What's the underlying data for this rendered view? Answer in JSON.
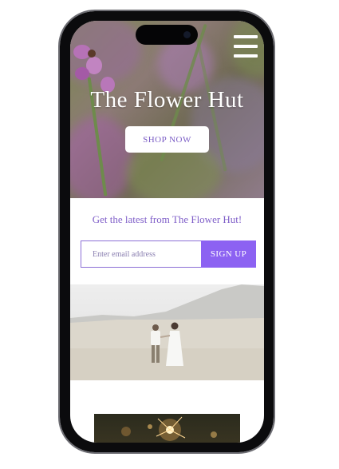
{
  "hero": {
    "brand_title": "The Flower Hut",
    "shop_button": "SHOP NOW",
    "menu_icon": "hamburger-menu-icon"
  },
  "newsletter": {
    "heading": "Get the latest from The Flower Hut!",
    "email_placeholder": "Enter email address",
    "signup_button": "SIGN UP"
  },
  "colors": {
    "accent": "#8c62f2",
    "accent_text": "#8060c9",
    "frame": "#0b0b0d"
  }
}
